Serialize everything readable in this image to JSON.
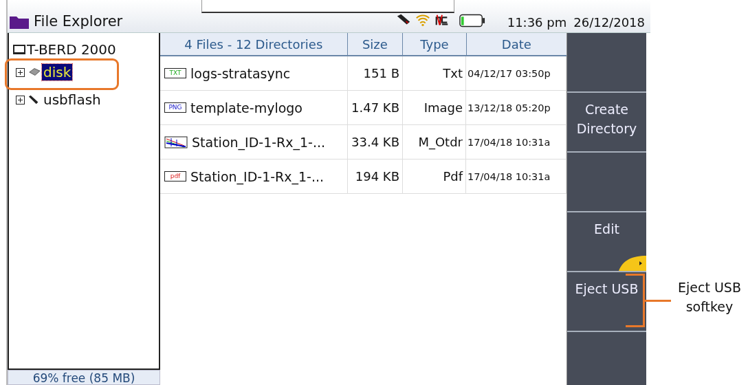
{
  "window": {
    "title": "File Explorer"
  },
  "status_bar": {
    "time": "11:36 pm",
    "date": "26/12/2018"
  },
  "tree": {
    "label": "T-BERD 2000",
    "children": [
      {
        "label": "disk",
        "kind": "disk",
        "expanded": false,
        "selected": true
      },
      {
        "label": "usbflash",
        "kind": "usb",
        "expanded": false,
        "selected": false
      }
    ]
  },
  "free_space": "69% free (85 MB)",
  "table": {
    "columns": [
      "4 Files - 12 Directories",
      "Size",
      "Type",
      "Date"
    ],
    "rows": [
      {
        "kind": "txt",
        "icon_label": "TXT",
        "name": "logs-stratasync",
        "size": "151 B",
        "type": "Txt",
        "date": "04/12/17 03:50p"
      },
      {
        "kind": "png",
        "icon_label": "PNG",
        "name": "template-mylogo",
        "size": "1.47 KB",
        "type": "Image",
        "date": "13/12/18 05:20p"
      },
      {
        "kind": "otdr",
        "name": "Station_ID-1-Rx_1-...",
        "size": "33.4 KB",
        "type": "M_Otdr",
        "date": "17/04/18 10:31a"
      },
      {
        "kind": "pdf",
        "icon_label": "pdf",
        "name": "Station_ID-1-Rx_1-...",
        "size": "194 KB",
        "type": "Pdf",
        "date": "17/04/18 10:31a"
      }
    ]
  },
  "softkeys": [
    {
      "label": "Create Directory",
      "blank_above": true
    },
    {
      "label": "Edit",
      "blank_above": true,
      "tab": true
    },
    {
      "label": "Eject USB",
      "blank_above": false
    }
  ],
  "callout": {
    "label": "Eject USB softkey"
  }
}
